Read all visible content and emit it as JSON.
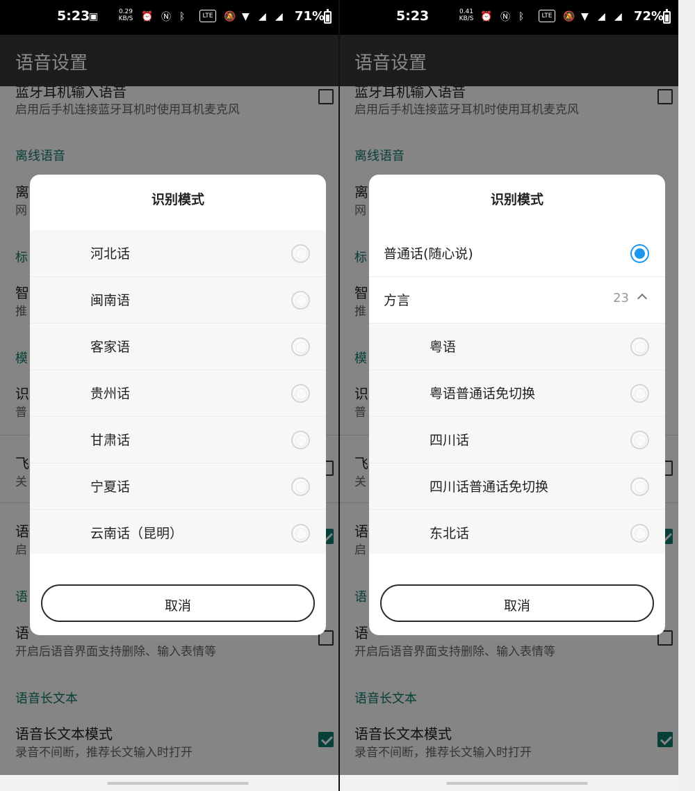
{
  "screens": [
    {
      "status": {
        "time": "5:23",
        "net_speed": "0.29",
        "net_unit": "KB/S",
        "battery": "71%"
      },
      "appbar_title": "语音设置",
      "settings": {
        "bt_title": "蓝牙耳机输入语音",
        "bt_sub": "启用后手机连接蓝牙耳机时使用耳机麦克风",
        "section_offline": "离线语音",
        "offline_peek": "离",
        "offline_sub_peek": "网",
        "section_std_peek": "标",
        "smart_peek": "智",
        "smart_sub_peek": "推",
        "section_mode_peek": "模",
        "mode_peek": "识",
        "mode_sub_peek": "普",
        "fly_peek": "飞",
        "fly_sub_peek": "关",
        "voice_peek": "语",
        "voice_sub_peek": "启",
        "section_voice_peek": "语",
        "panel_title_peek": "语",
        "panel_sub": "开启后语音界面支持删除、输入表情等",
        "section_long": "语音长文本",
        "long_title": "语音长文本模式",
        "long_sub": "录音不间断，推荐长文输入时打开"
      },
      "dialog": {
        "title": "识别模式",
        "options": [
          "河北话",
          "闽南语",
          "客家语",
          "贵州话",
          "甘肃话",
          "宁夏话",
          "云南话（昆明）"
        ],
        "cancel": "取消"
      }
    },
    {
      "status": {
        "time": "5:23",
        "net_speed": "0.41",
        "net_unit": "KB/S",
        "battery": "72%"
      },
      "appbar_title": "语音设置",
      "settings": {
        "bt_title": "蓝牙耳机输入语音",
        "bt_sub": "启用后手机连接蓝牙耳机时使用耳机麦克风",
        "section_offline": "离线语音",
        "offline_peek": "离",
        "offline_sub_peek": "网",
        "section_std_peek": "标",
        "smart_peek": "智",
        "smart_sub_peek": "推",
        "section_mode_peek": "模",
        "mode_peek": "识",
        "mode_sub_peek": "普",
        "fly_peek": "飞",
        "fly_sub_peek": "关",
        "voice_peek": "语",
        "voice_sub_peek": "启",
        "section_voice_peek": "语",
        "panel_title_peek": "语",
        "panel_sub": "开启后语音界面支持删除、输入表情等",
        "section_long": "语音长文本",
        "long_title": "语音长文本模式",
        "long_sub": "录音不间断，推荐长文输入时打开"
      },
      "dialog": {
        "title": "识别模式",
        "mandarin": "普通话(随心说)",
        "dialect_group": "方言",
        "dialect_count": "23",
        "options": [
          "粤语",
          "粤语普通话免切换",
          "四川话",
          "四川话普通话免切换",
          "东北话"
        ],
        "cancel": "取消"
      }
    }
  ],
  "colors": {
    "accent": "#117a6c",
    "radio_selected": "#1e96f0",
    "appbar": "#1d1d1d"
  }
}
